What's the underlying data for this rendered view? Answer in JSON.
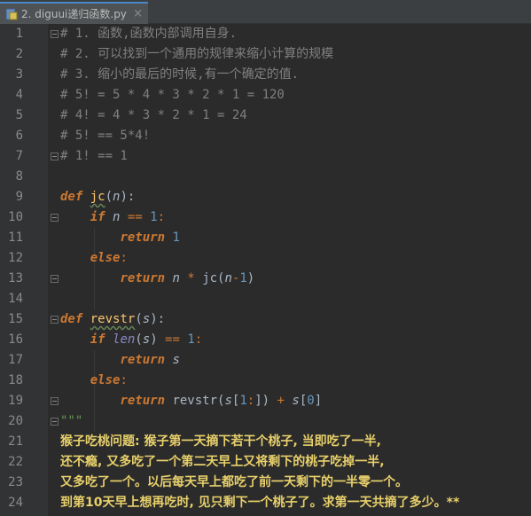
{
  "tab": {
    "title": "2. diguui递归函数.py",
    "close": "×"
  },
  "lines": [
    {
      "n": "1",
      "segments": [
        {
          "t": "# 1. 函数,函数内部调用自身.",
          "c": "comment"
        }
      ]
    },
    {
      "n": "2",
      "segments": [
        {
          "t": "# 2. 可以找到一个通用的规律来缩小计算的规模",
          "c": "comment"
        }
      ]
    },
    {
      "n": "3",
      "segments": [
        {
          "t": "# 3. 缩小的最后的时候,有一个确定的值.",
          "c": "comment"
        }
      ]
    },
    {
      "n": "4",
      "segments": [
        {
          "t": "# 5! = 5 * 4 * 3 * 2 * 1 = 120",
          "c": "comment"
        }
      ]
    },
    {
      "n": "5",
      "segments": [
        {
          "t": "# 4! = 4 * 3 * 2 * 1 = 24",
          "c": "comment"
        }
      ]
    },
    {
      "n": "6",
      "segments": [
        {
          "t": "# 5! == 5*4!",
          "c": "comment"
        }
      ]
    },
    {
      "n": "7",
      "segments": [
        {
          "t": "# 1! == 1",
          "c": "comment"
        }
      ]
    },
    {
      "n": "8",
      "segments": []
    },
    {
      "n": "9",
      "segments": [
        {
          "t": "def",
          "c": "kw"
        },
        {
          "t": " ",
          "c": ""
        },
        {
          "t": "jc",
          "c": "fn"
        },
        {
          "t": "(",
          "c": ""
        },
        {
          "t": "n",
          "c": "param"
        },
        {
          "t": "):",
          "c": ""
        }
      ]
    },
    {
      "n": "10",
      "segments": [
        {
          "t": "    ",
          "c": ""
        },
        {
          "t": "if",
          "c": "kw"
        },
        {
          "t": " ",
          "c": ""
        },
        {
          "t": "n",
          "c": "param"
        },
        {
          "t": " == ",
          "c": "op"
        },
        {
          "t": "1",
          "c": "num"
        },
        {
          "t": ":",
          "c": "op"
        }
      ]
    },
    {
      "n": "11",
      "segments": [
        {
          "t": "        ",
          "c": ""
        },
        {
          "t": "return",
          "c": "kw"
        },
        {
          "t": " ",
          "c": ""
        },
        {
          "t": "1",
          "c": "num"
        }
      ]
    },
    {
      "n": "12",
      "segments": [
        {
          "t": "    ",
          "c": ""
        },
        {
          "t": "else",
          "c": "kw"
        },
        {
          "t": ":",
          "c": "op"
        }
      ]
    },
    {
      "n": "13",
      "segments": [
        {
          "t": "        ",
          "c": ""
        },
        {
          "t": "return",
          "c": "kw"
        },
        {
          "t": " ",
          "c": ""
        },
        {
          "t": "n",
          "c": "param"
        },
        {
          "t": " * ",
          "c": "op"
        },
        {
          "t": "jc(",
          "c": ""
        },
        {
          "t": "n",
          "c": "param"
        },
        {
          "t": "-",
          "c": "op"
        },
        {
          "t": "1",
          "c": "num"
        },
        {
          "t": ")",
          "c": ""
        }
      ]
    },
    {
      "n": "14",
      "segments": []
    },
    {
      "n": "15",
      "segments": [
        {
          "t": "def",
          "c": "kw"
        },
        {
          "t": " ",
          "c": ""
        },
        {
          "t": "revstr",
          "c": "fn"
        },
        {
          "t": "(",
          "c": ""
        },
        {
          "t": "s",
          "c": "param"
        },
        {
          "t": "):",
          "c": ""
        }
      ]
    },
    {
      "n": "16",
      "segments": [
        {
          "t": "    ",
          "c": ""
        },
        {
          "t": "if",
          "c": "kw"
        },
        {
          "t": " ",
          "c": ""
        },
        {
          "t": "len",
          "c": "builtin"
        },
        {
          "t": "(",
          "c": ""
        },
        {
          "t": "s",
          "c": "param"
        },
        {
          "t": ")",
          "c": ""
        },
        {
          "t": " == ",
          "c": "op"
        },
        {
          "t": "1",
          "c": "num"
        },
        {
          "t": ":",
          "c": "op"
        }
      ]
    },
    {
      "n": "17",
      "segments": [
        {
          "t": "        ",
          "c": ""
        },
        {
          "t": "return",
          "c": "kw"
        },
        {
          "t": " ",
          "c": ""
        },
        {
          "t": "s",
          "c": "param"
        }
      ]
    },
    {
      "n": "18",
      "segments": [
        {
          "t": "    ",
          "c": ""
        },
        {
          "t": "else",
          "c": "kw"
        },
        {
          "t": ":",
          "c": "op"
        }
      ]
    },
    {
      "n": "19",
      "segments": [
        {
          "t": "        ",
          "c": ""
        },
        {
          "t": "return",
          "c": "kw"
        },
        {
          "t": " revstr(",
          "c": ""
        },
        {
          "t": "s",
          "c": "param"
        },
        {
          "t": "[",
          "c": ""
        },
        {
          "t": "1",
          "c": "num"
        },
        {
          "t": ":",
          "c": "op"
        },
        {
          "t": "]) ",
          "c": ""
        },
        {
          "t": "+",
          "c": "op"
        },
        {
          "t": " ",
          "c": ""
        },
        {
          "t": "s",
          "c": "param"
        },
        {
          "t": "[",
          "c": ""
        },
        {
          "t": "0",
          "c": "num"
        },
        {
          "t": "]",
          "c": ""
        }
      ]
    },
    {
      "n": "20",
      "segments": [
        {
          "t": "\"\"\"",
          "c": "doc"
        }
      ]
    },
    {
      "n": "21",
      "segments": [
        {
          "t": "猴子吃桃问题: 猴子第一天摘下若干个桃子, 当即吃了一半,",
          "c": "docbold"
        }
      ]
    },
    {
      "n": "22",
      "segments": [
        {
          "t": "还不瘾, 又多吃了一个第二天早上又将剩下的桃子吃掉一半,",
          "c": "docbold"
        }
      ]
    },
    {
      "n": "23",
      "segments": [
        {
          "t": "又多吃了一个。以后每天早上都吃了前一天剩下的一半零一个。",
          "c": "docbold"
        }
      ]
    },
    {
      "n": "24",
      "segments": [
        {
          "t": "到第10天早上想再吃时, 见只剩下一个桃子了。求第一天共摘了多少。**",
          "c": "docbold"
        }
      ]
    }
  ]
}
